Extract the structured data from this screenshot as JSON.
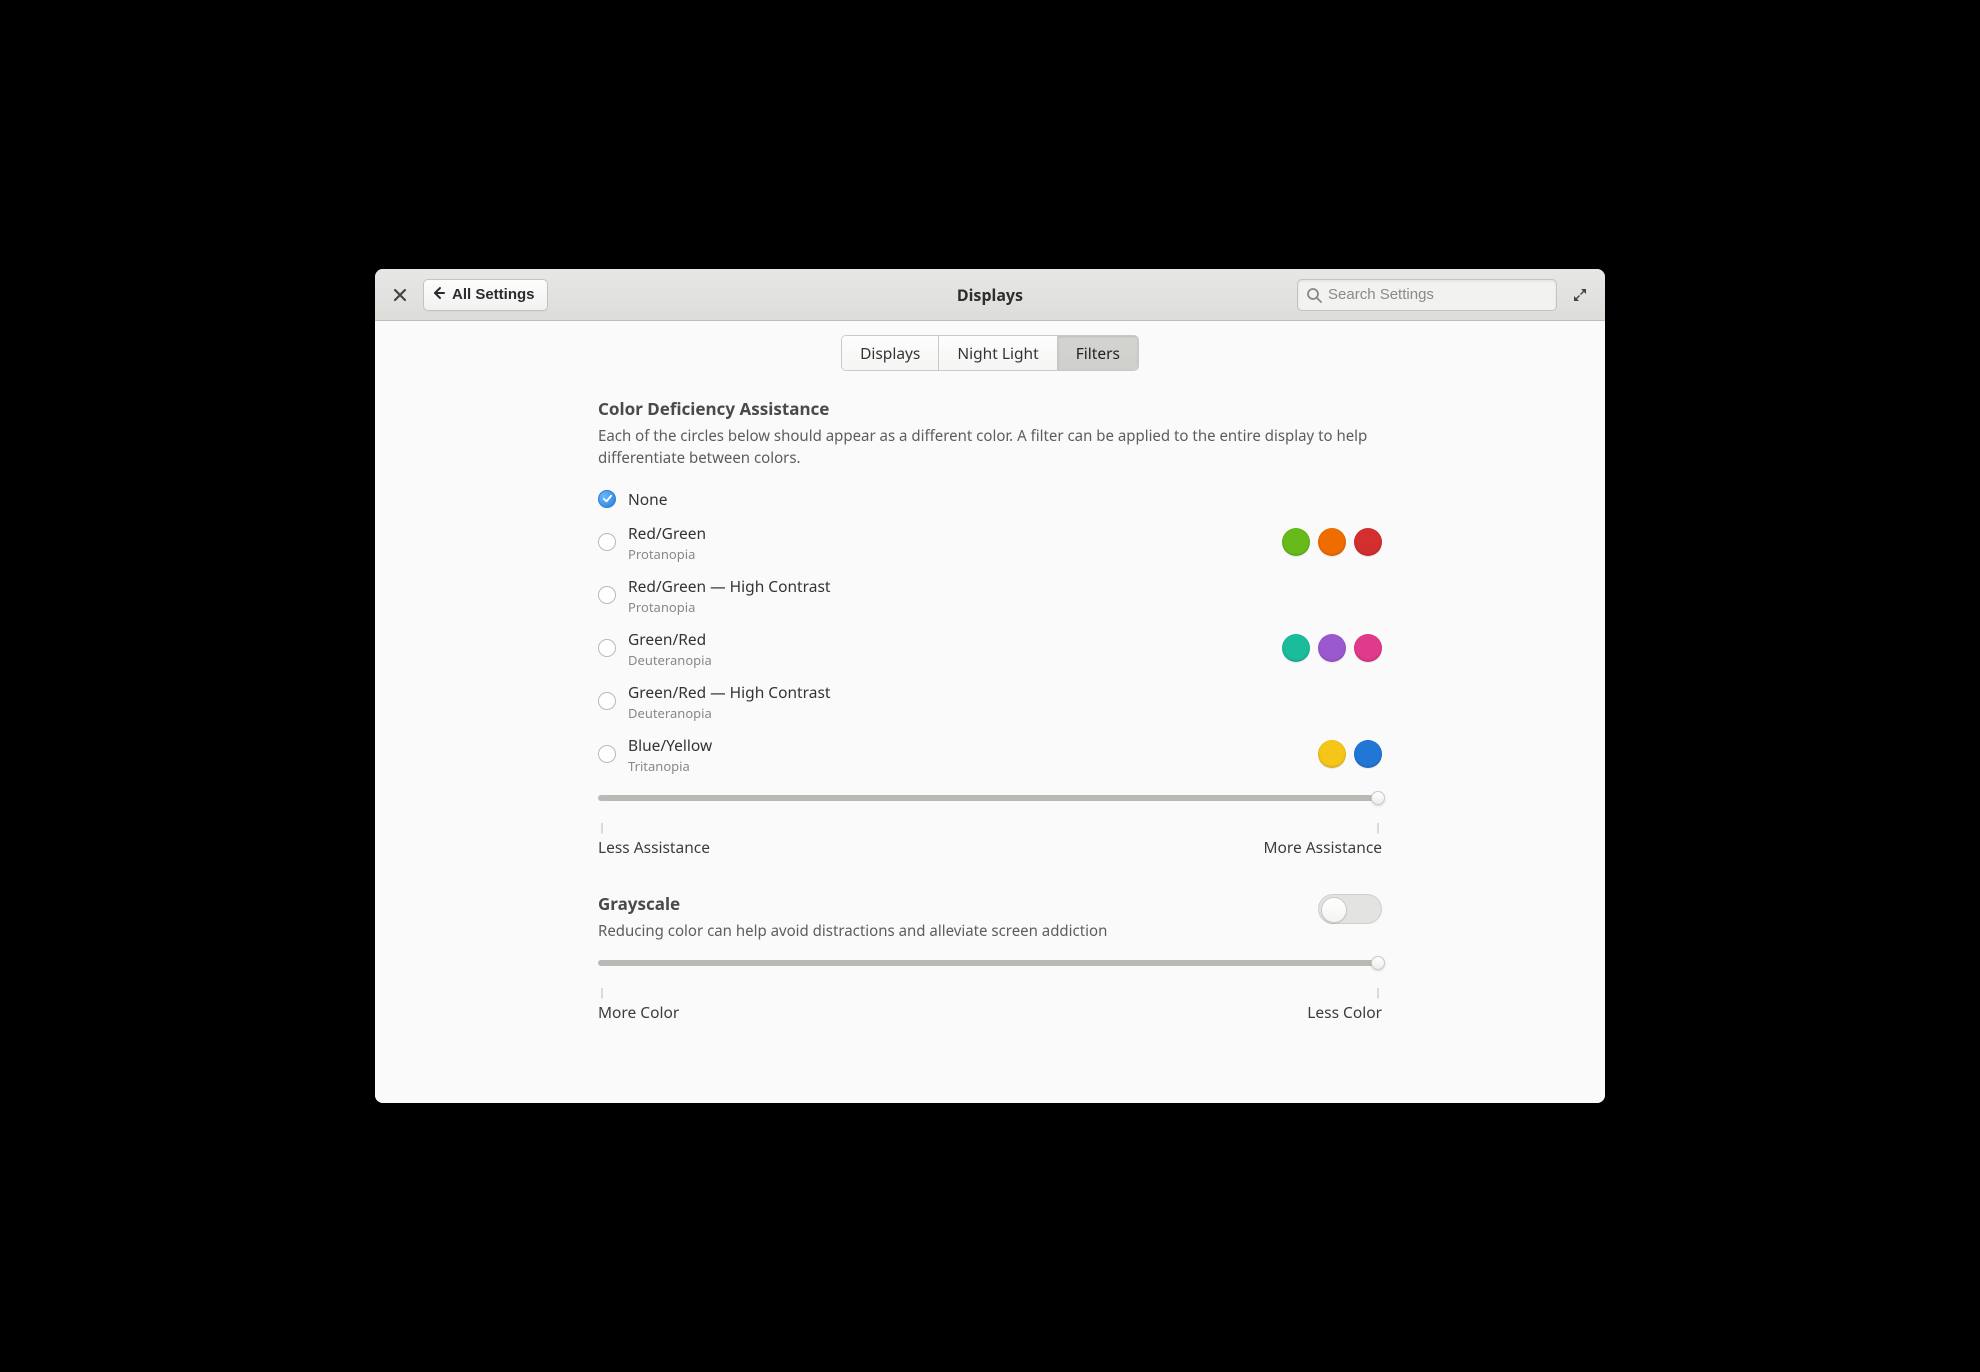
{
  "header": {
    "back_label": "All Settings",
    "title": "Displays",
    "search_placeholder": "Search Settings"
  },
  "tabs": [
    {
      "label": "Displays",
      "active": false
    },
    {
      "label": "Night Light",
      "active": false
    },
    {
      "label": "Filters",
      "active": true
    }
  ],
  "color_deficiency": {
    "title": "Color Deficiency Assistance",
    "description": "Each of the circles below should appear as a different color. A filter can be applied to the entire display to help differentiate between colors.",
    "options": [
      {
        "title": "None",
        "sub": "",
        "selected": true,
        "swatches": []
      },
      {
        "title": "Red/Green",
        "sub": "Protanopia",
        "selected": false,
        "swatches": [
          "#66bb1a",
          "#ef6c00",
          "#d32f2f"
        ]
      },
      {
        "title": "Red/Green — High Contrast",
        "sub": "Protanopia",
        "selected": false,
        "swatches": []
      },
      {
        "title": "Green/Red",
        "sub": "Deuteranopia",
        "selected": false,
        "swatches": [
          "#1abc9c",
          "#9b59d0",
          "#e03a8a"
        ]
      },
      {
        "title": "Green/Red — High Contrast",
        "sub": "Deuteranopia",
        "selected": false,
        "swatches": []
      },
      {
        "title": "Blue/Yellow",
        "sub": "Tritanopia",
        "selected": false,
        "swatches": [
          "#f5c518",
          "#2176d6"
        ]
      }
    ],
    "slider": {
      "left": "Less Assistance",
      "right": "More Assistance"
    }
  },
  "grayscale": {
    "title": "Grayscale",
    "description": "Reducing color can help avoid distractions and alleviate screen addiction",
    "enabled": false,
    "slider": {
      "left": "More Color",
      "right": "Less Color"
    }
  }
}
